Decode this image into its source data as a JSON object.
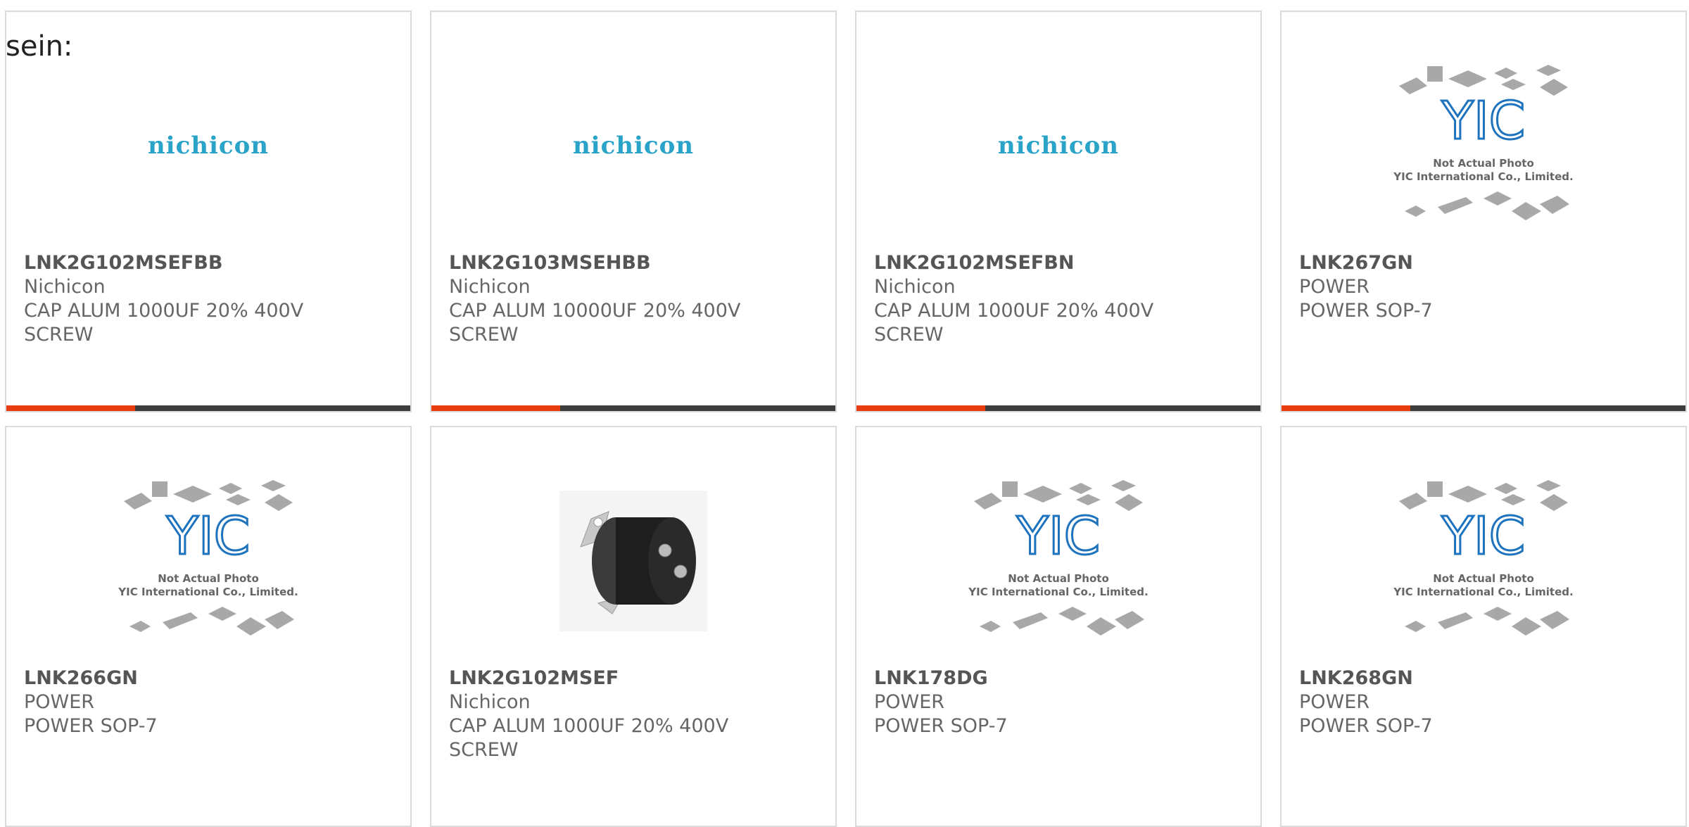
{
  "heading": "sein:",
  "colors": {
    "nichicon": "#2aa3c9",
    "accent": "#e63c0f",
    "bar": "#3d3d3d",
    "yic": "#1e73be"
  },
  "products": [
    {
      "part": "LNK2G102MSEFBB",
      "lines": [
        "Nichicon",
        "CAP ALUM 1000UF 20% 400V",
        "SCREW"
      ],
      "image": "nichicon-logo",
      "logo_text": "nichicon"
    },
    {
      "part": "LNK2G103MSEHBB",
      "lines": [
        "Nichicon",
        "CAP ALUM 10000UF 20% 400V",
        "SCREW"
      ],
      "image": "nichicon-logo",
      "logo_text": "nichicon"
    },
    {
      "part": "LNK2G102MSEFBN",
      "lines": [
        "Nichicon",
        "CAP ALUM 1000UF 20% 400V",
        "SCREW"
      ],
      "image": "nichicon-logo",
      "logo_text": "nichicon"
    },
    {
      "part": "LNK267GN",
      "lines": [
        "POWER",
        "POWER SOP-7"
      ],
      "image": "yic-placeholder",
      "caption1": "Not Actual Photo",
      "caption2": "YIC International Co., Limited."
    },
    {
      "part": "LNK266GN",
      "lines": [
        "POWER",
        "POWER SOP-7"
      ],
      "image": "yic-placeholder",
      "caption1": "Not Actual Photo",
      "caption2": "YIC International Co., Limited."
    },
    {
      "part": "LNK2G102MSEF",
      "lines": [
        "Nichicon",
        "CAP ALUM 1000UF 20% 400V",
        "SCREW"
      ],
      "image": "capacitor-photo"
    },
    {
      "part": "LNK178DG",
      "lines": [
        "POWER",
        "POWER SOP-7"
      ],
      "image": "yic-placeholder",
      "caption1": "Not Actual Photo",
      "caption2": "YIC International Co., Limited."
    },
    {
      "part": "LNK268GN",
      "lines": [
        "POWER",
        "POWER SOP-7"
      ],
      "image": "yic-placeholder",
      "caption1": "Not Actual Photo",
      "caption2": "YIC International Co., Limited."
    }
  ]
}
